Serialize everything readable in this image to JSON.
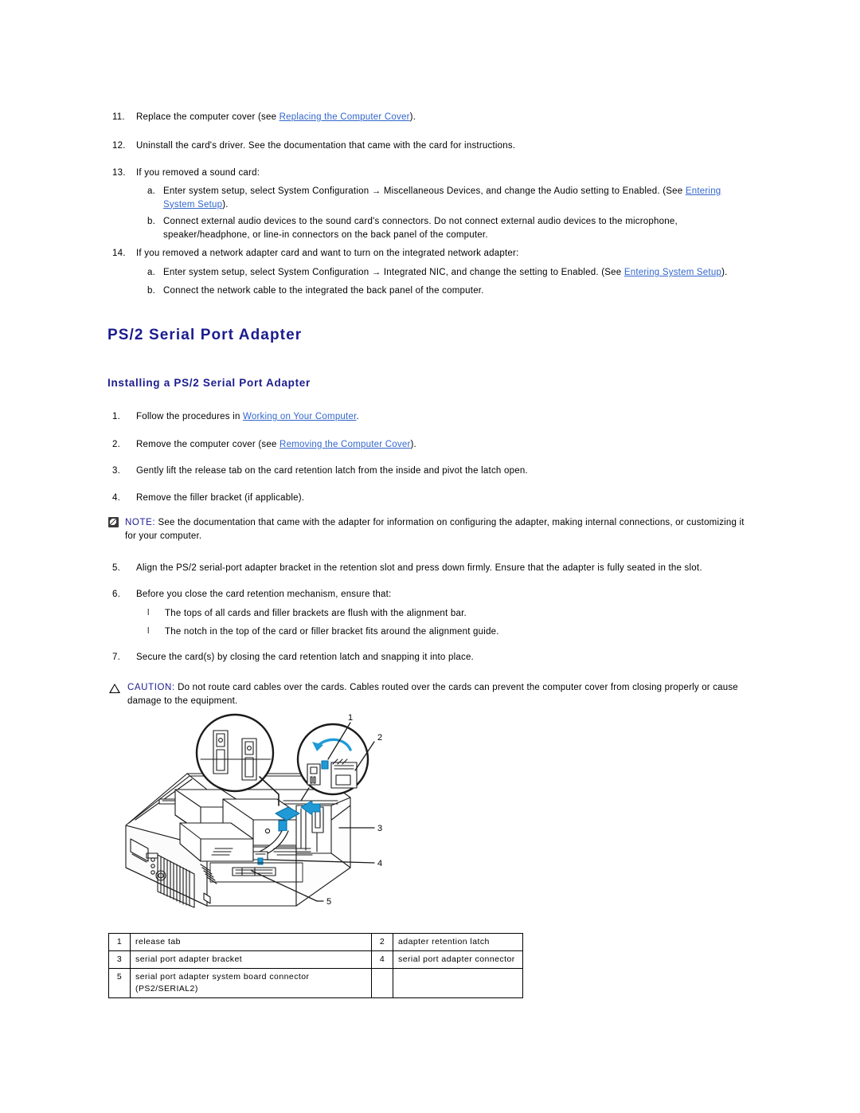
{
  "document": {
    "heading": "PS/2 Serial Port Adapter",
    "subheading": "Installing a PS/2 Serial Port Adapter"
  },
  "top_steps": [
    {
      "marker": "11.",
      "text_before": "Replace the computer cover (see ",
      "link": "Replacing the Computer Cover",
      "text_after": ")."
    },
    {
      "marker": "12.",
      "text_before": "Uninstall the card's driver. See the documentation that came with the card for instructions.",
      "link": "",
      "text_after": ""
    },
    {
      "marker": "13.",
      "text_before": "If you removed a sound card:",
      "link": "",
      "text_after": ""
    }
  ],
  "sound_card_substeps": [
    {
      "marker": "a.",
      "text_before": "Enter system setup, select System Configuration → Miscellaneous Devices, and change the Audio setting to Enabled. (See ",
      "link": "Entering System Setup",
      "text_after": ")."
    },
    {
      "marker": "b.",
      "text_before": "Connect external audio devices to the sound card's connectors. Do not connect external audio devices to the microphone, speaker/headphone, or line-in connectors on the back panel of the computer.",
      "link": "",
      "text_after": ""
    }
  ],
  "network_step": {
    "marker": "14.",
    "text": "If you removed a network adapter card and want to turn on the integrated network adapter:"
  },
  "network_substeps": [
    {
      "marker": "a.",
      "text_before": "Enter system setup, select System Configuration → Integrated NIC, and change the setting to Enabled. (See ",
      "link": "Entering System Setup",
      "text_after": ")."
    },
    {
      "marker": "b.",
      "text_before": "Connect the network cable to the integrated the back panel of the computer.",
      "link": "",
      "text_after": ""
    }
  ],
  "install_steps": [
    {
      "marker": "1.",
      "text_before": "Follow the procedures in ",
      "link": "Working on Your Computer",
      "text_after": "."
    },
    {
      "marker": "2.",
      "text_before": "Remove the computer cover (see ",
      "link": "Removing the Computer Cover",
      "text_after": ")."
    },
    {
      "marker": "3.",
      "text_before": "Gently lift the release tab on the card retention latch from the inside and pivot the latch open.",
      "link": "",
      "text_after": ""
    },
    {
      "marker": "4.",
      "text_before": "Remove the filler bracket (if applicable).",
      "link": "",
      "text_after": ""
    }
  ],
  "note": {
    "keyword": "NOTE:",
    "icon": "note-pencil-icon",
    "text": " See the documentation that came with the adapter for information on configuring the adapter, making internal connections, or customizing it for your computer."
  },
  "install_steps_2": [
    {
      "marker": "5.",
      "text": "Align the PS/2 serial-port adapter bracket in the retention slot and press down firmly. Ensure that the adapter is fully seated in the slot."
    },
    {
      "marker": "6.",
      "text": "Before you close the card retention mechanism, ensure that:"
    }
  ],
  "bullets": [
    {
      "marker": "l",
      "text": "The tops of all cards and filler brackets are flush with the alignment bar."
    },
    {
      "marker": "l",
      "text": "The notch in the top of the card or filler bracket fits around the alignment guide."
    }
  ],
  "install_step_7": {
    "marker": "7.",
    "text": "Secure the card(s) by closing the card retention latch and snapping it into place."
  },
  "caution": {
    "keyword": "CAUTION:",
    "icon": "warning-triangle-icon",
    "text": " Do not route card cables over the cards. Cables routed over the cards can prevent the computer cover from closing properly or cause damage to the equipment."
  },
  "figure": {
    "name": "ps2-serial-port-adapter-installation-diagram",
    "callouts": [
      "1",
      "2",
      "3",
      "4",
      "5"
    ],
    "accent_color": "#1f9ad6"
  },
  "legend": {
    "rows": [
      [
        {
          "num": "1",
          "label": "release tab"
        },
        {
          "num": "2",
          "label": "adapter retention latch"
        }
      ],
      [
        {
          "num": "3",
          "label": "serial port adapter bracket"
        },
        {
          "num": "4",
          "label": "serial port adapter connector"
        }
      ],
      [
        {
          "num": "5",
          "label": "serial port adapter system board connector (PS2/SERIAL2)"
        },
        {
          "num": "",
          "label": ""
        }
      ]
    ]
  }
}
